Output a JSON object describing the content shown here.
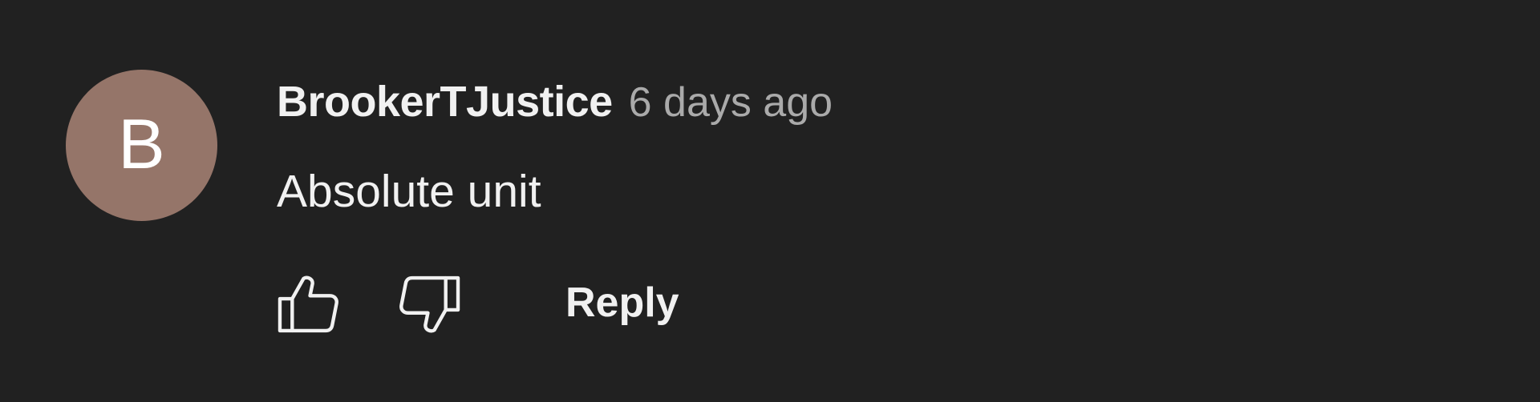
{
  "comment": {
    "avatar_letter": "B",
    "author": "BrookerTJustice",
    "timestamp": "6 days ago",
    "text": "Absolute unit",
    "reply_label": "Reply"
  },
  "icons": {
    "like": "thumbs-up-icon",
    "dislike": "thumbs-down-icon"
  },
  "colors": {
    "background": "#212121",
    "avatar": "#957569",
    "text": "#f1f1f1",
    "secondary_text": "#aaaaaa"
  }
}
